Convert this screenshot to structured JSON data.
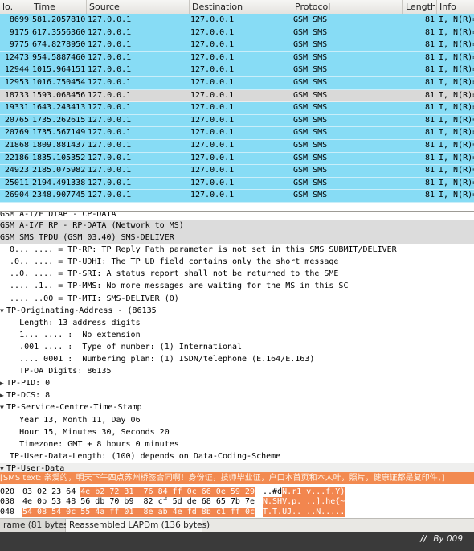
{
  "packet_list": {
    "columns": {
      "no": "lo.",
      "time": "Time",
      "source": "Source",
      "destination": "Destination",
      "protocol": "Protocol",
      "length": "Length",
      "info": "Info"
    },
    "rows": [
      {
        "no": "8699",
        "time": "581.2057810",
        "src": "127.0.0.1",
        "dst": "127.0.0.1",
        "proto": "GSM SMS",
        "len": "81",
        "info": "I, N(R)="
      },
      {
        "no": "9175",
        "time": "617.3556360",
        "src": "127.0.0.1",
        "dst": "127.0.0.1",
        "proto": "GSM SMS",
        "len": "81",
        "info": "I, N(R)="
      },
      {
        "no": "9775",
        "time": "674.8278950",
        "src": "127.0.0.1",
        "dst": "127.0.0.1",
        "proto": "GSM SMS",
        "len": "81",
        "info": "I, N(R)="
      },
      {
        "no": "12473",
        "time": "954.5887460",
        "src": "127.0.0.1",
        "dst": "127.0.0.1",
        "proto": "GSM SMS",
        "len": "81",
        "info": "I, N(R)="
      },
      {
        "no": "12944",
        "time": "1015.964151",
        "src": "127.0.0.1",
        "dst": "127.0.0.1",
        "proto": "GSM SMS",
        "len": "81",
        "info": "I, N(R)="
      },
      {
        "no": "12953",
        "time": "1016.750454",
        "src": "127.0.0.1",
        "dst": "127.0.0.1",
        "proto": "GSM SMS",
        "len": "81",
        "info": "I, N(R)="
      },
      {
        "no": "18733",
        "time": "1593.068456",
        "src": "127.0.0.1",
        "dst": "127.0.0.1",
        "proto": "GSM SMS",
        "len": "81",
        "info": "I, N(R)="
      },
      {
        "no": "19331",
        "time": "1643.243413",
        "src": "127.0.0.1",
        "dst": "127.0.0.1",
        "proto": "GSM SMS",
        "len": "81",
        "info": "I, N(R)="
      },
      {
        "no": "20765",
        "time": "1735.262615",
        "src": "127.0.0.1",
        "dst": "127.0.0.1",
        "proto": "GSM SMS",
        "len": "81",
        "info": "I, N(R)="
      },
      {
        "no": "20769",
        "time": "1735.567149",
        "src": "127.0.0.1",
        "dst": "127.0.0.1",
        "proto": "GSM SMS",
        "len": "81",
        "info": "I, N(R)="
      },
      {
        "no": "21868",
        "time": "1809.881437",
        "src": "127.0.0.1",
        "dst": "127.0.0.1",
        "proto": "GSM SMS",
        "len": "81",
        "info": "I, N(R)="
      },
      {
        "no": "22186",
        "time": "1835.105352",
        "src": "127.0.0.1",
        "dst": "127.0.0.1",
        "proto": "GSM SMS",
        "len": "81",
        "info": "I, N(R)="
      },
      {
        "no": "24923",
        "time": "2185.075982",
        "src": "127.0.0.1",
        "dst": "127.0.0.1",
        "proto": "GSM SMS",
        "len": "81",
        "info": "I, N(R)="
      },
      {
        "no": "25011",
        "time": "2194.491338",
        "src": "127.0.0.1",
        "dst": "127.0.0.1",
        "proto": "GSM SMS",
        "len": "81",
        "info": "I, N(R)="
      },
      {
        "no": "26904",
        "time": "2348.907745",
        "src": "127.0.0.1",
        "dst": "127.0.0.1",
        "proto": "GSM SMS",
        "len": "81",
        "info": "I, N(R)="
      }
    ],
    "selected_row": "18733",
    "colors": {
      "row": "#87dcf5",
      "selected": "#d9d9d8"
    }
  },
  "details": {
    "lines": [
      {
        "text": "GSM A-I/F DTAP - CP-DATA",
        "tw": "",
        "style": "cut"
      },
      {
        "text": "GSM A-I/F RP - RP-DATA (Network to MS)",
        "tw": "",
        "style": "hl"
      },
      {
        "text": "GSM SMS TPDU (GSM 03.40) SMS-DELIVER",
        "tw": "",
        "style": "hl"
      },
      {
        "text": "  0... .... = TP-RP: TP Reply Path parameter is not set in this SMS SUBMIT/DELIVER",
        "tw": "",
        "style": ""
      },
      {
        "text": "  .0.. .... = TP-UDHI: The TP UD field contains only the short message",
        "tw": "",
        "style": ""
      },
      {
        "text": "  ..0. .... = TP-SRI: A status report shall not be returned to the SME",
        "tw": "",
        "style": ""
      },
      {
        "text": "  .... .1.. = TP-MMS: No more messages are waiting for the MS in this SC",
        "tw": "",
        "style": ""
      },
      {
        "text": "  .... ..00 = TP-MTI: SMS-DELIVER (0)",
        "tw": "",
        "style": ""
      },
      {
        "text": "TP-Originating-Address - (86135",
        "tw": "▼",
        "style": ""
      },
      {
        "text": "    Length: 13 address digits",
        "tw": "",
        "style": ""
      },
      {
        "text": "    1... .... :  No extension",
        "tw": "",
        "style": ""
      },
      {
        "text": "    .001 .... :  Type of number: (1) International",
        "tw": "",
        "style": ""
      },
      {
        "text": "    .... 0001 :  Numbering plan: (1) ISDN/telephone (E.164/E.163)",
        "tw": "",
        "style": ""
      },
      {
        "text": "    TP-OA Digits: 86135",
        "tw": "",
        "style": ""
      },
      {
        "text": "TP-PID: 0",
        "tw": "▶",
        "style": ""
      },
      {
        "text": "TP-DCS: 8",
        "tw": "▶",
        "style": ""
      },
      {
        "text": "TP-Service-Centre-Time-Stamp",
        "tw": "▼",
        "style": ""
      },
      {
        "text": "    Year 13, Month 11, Day 06",
        "tw": "",
        "style": ""
      },
      {
        "text": "    Hour 15, Minutes 30, Seconds 20",
        "tw": "",
        "style": ""
      },
      {
        "text": "    Timezone: GMT + 8 hours 0 minutes",
        "tw": "",
        "style": ""
      },
      {
        "text": "  TP-User-Data-Length: (100) depends on Data-Coding-Scheme",
        "tw": "",
        "style": ""
      },
      {
        "text": "TP-User-Data",
        "tw": "▼",
        "style": "tp"
      }
    ],
    "sms_text": "    [SMS text: 亲爱的，明天下午四点苏州桥签合同啊！身份证，技师毕业证，户口本首页和本人叶，照片，健康证都是复印件，]",
    "highlight_color": "#f28a50"
  },
  "bytes": {
    "rows": [
      {
        "offset": "020",
        "hex_plain": "03 02 23 64 ",
        "hex_hl": "4e b2 72 31  76 84 ff 0c 66 0e 59 29",
        "ascii_plain": "..#d",
        "ascii_hl": "N.r1 v...f.Y)"
      },
      {
        "offset": "030",
        "hex_plain": "4e 0b 53 48 56 db 70 b9  82 cf 5d de 68 65 7b 7e",
        "hex_hl": "",
        "ascii_plain": "",
        "ascii_hl": "N.SHV.p. ..].he{~"
      },
      {
        "offset": "040",
        "hex_plain": "",
        "hex_hl": "54 08 54 0c 55 4a ff 01  8e ab 4e fd 8b c1 ff 0c",
        "ascii_plain": "",
        "ascii_hl": "T.T.UJ.. ..N....."
      }
    ],
    "highlight_color": "#f2864f"
  },
  "tabs": {
    "frame": "rame (81 bytes)",
    "reassembled": "Reassembled LAPDm (136 bytes)"
  },
  "watermark": {
    "slashes": "//",
    "text": "By 009"
  }
}
